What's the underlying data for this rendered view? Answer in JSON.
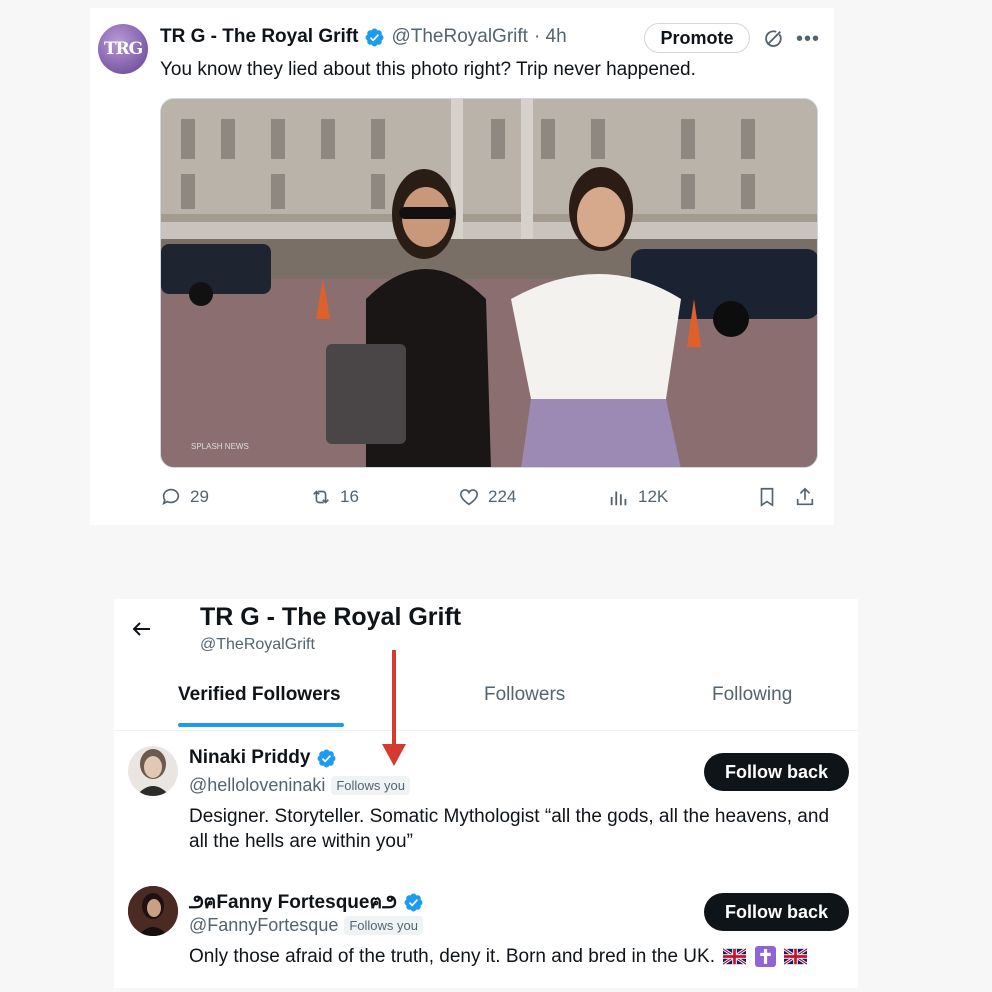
{
  "tweet": {
    "avatar_text": "TRG",
    "author_name": "TR G - The Royal Grift",
    "author_handle": "@TheRoyalGrift",
    "time": "· 4h",
    "promote_label": "Promote",
    "text": "You know they lied about this photo right?  Trip never happened.",
    "photo_credit": "SPLASH NEWS",
    "replies": "29",
    "retweets": "16",
    "likes": "224",
    "views": "12K"
  },
  "profile": {
    "name": "TR G - The Royal Grift",
    "handle": "@TheRoyalGrift",
    "tabs": [
      {
        "label": "Verified Followers",
        "active": true
      },
      {
        "label": "Followers",
        "active": false
      },
      {
        "label": "Following",
        "active": false
      }
    ]
  },
  "followers": [
    {
      "name": "Ninaki Priddy",
      "handle": "@helloloveninaki",
      "badge": "Follows you",
      "bio": "Designer. Storyteller. Somatic Mythologist “all the gods, all the heavens, and all the hells are within you”",
      "button": "Follow back"
    },
    {
      "name": "౨ฅFanny Fortesqueฅ౨",
      "handle": "@FannyFortesque",
      "badge": "Follows you",
      "bio": "Only those afraid of the truth, deny it. Born and bred in the UK.",
      "button": "Follow back"
    }
  ],
  "colors": {
    "verified_blue": "#1d9bf0",
    "annotation_red": "#d63a2f",
    "follow_button": "#0f1419"
  }
}
